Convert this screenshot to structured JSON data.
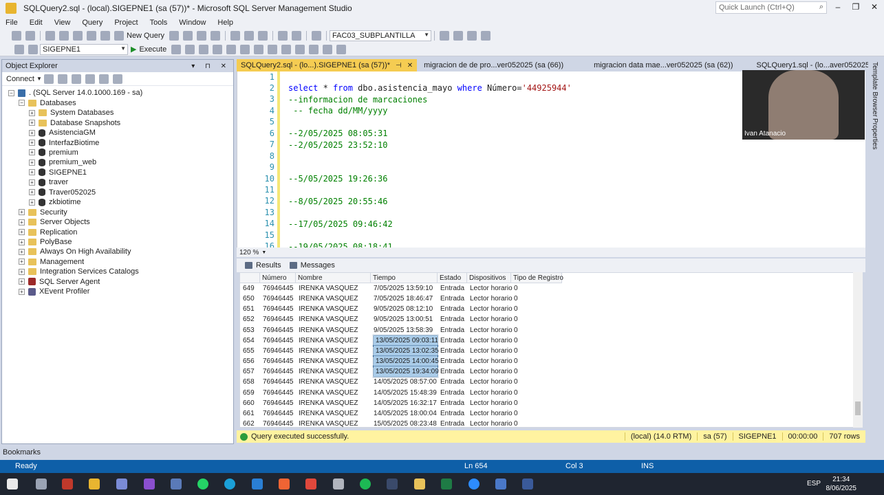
{
  "window": {
    "title": "SQLQuery2.sql - (local).SIGEPNE1 (sa (57))* - Microsoft SQL Server Management Studio",
    "quick_launch_placeholder": "Quick Launch (Ctrl+Q)"
  },
  "menu": [
    "File",
    "Edit",
    "View",
    "Query",
    "Project",
    "Tools",
    "Window",
    "Help"
  ],
  "toolbar": {
    "new_query": "New Query",
    "solution_combo": "FAC03_SUBPLANTILLA",
    "database_combo": "SIGEPNE1",
    "execute": "Execute"
  },
  "object_explorer": {
    "title": "Object Explorer",
    "connect": "Connect",
    "tree": [
      {
        "label": ". (SQL Server 14.0.1000.169 - sa)",
        "level": 0,
        "icon": "server-icon",
        "exp": "−"
      },
      {
        "label": "Databases",
        "level": 1,
        "icon": "folder-icon",
        "exp": "−"
      },
      {
        "label": "System Databases",
        "level": 2,
        "icon": "folder-icon",
        "exp": "+"
      },
      {
        "label": "Database Snapshots",
        "level": 2,
        "icon": "folder-icon",
        "exp": "+"
      },
      {
        "label": "AsistenciaGM",
        "level": 2,
        "icon": "database-icon",
        "exp": "+"
      },
      {
        "label": "InterfazBiotime",
        "level": 2,
        "icon": "database-icon",
        "exp": "+"
      },
      {
        "label": "premium",
        "level": 2,
        "icon": "database-icon",
        "exp": "+"
      },
      {
        "label": "premium_web",
        "level": 2,
        "icon": "database-icon",
        "exp": "+"
      },
      {
        "label": "SIGEPNE1",
        "level": 2,
        "icon": "database-icon",
        "exp": "+"
      },
      {
        "label": "traver",
        "level": 2,
        "icon": "database-icon",
        "exp": "+"
      },
      {
        "label": "Traver052025",
        "level": 2,
        "icon": "database-icon",
        "exp": "+"
      },
      {
        "label": "zkbiotime",
        "level": 2,
        "icon": "database-icon",
        "exp": "+"
      },
      {
        "label": "Security",
        "level": 1,
        "icon": "folder-icon",
        "exp": "+"
      },
      {
        "label": "Server Objects",
        "level": 1,
        "icon": "folder-icon",
        "exp": "+"
      },
      {
        "label": "Replication",
        "level": 1,
        "icon": "folder-icon",
        "exp": "+"
      },
      {
        "label": "PolyBase",
        "level": 1,
        "icon": "folder-icon",
        "exp": "+"
      },
      {
        "label": "Always On High Availability",
        "level": 1,
        "icon": "folder-icon",
        "exp": "+"
      },
      {
        "label": "Management",
        "level": 1,
        "icon": "folder-icon",
        "exp": "+"
      },
      {
        "label": "Integration Services Catalogs",
        "level": 1,
        "icon": "folder-icon",
        "exp": "+"
      },
      {
        "label": "SQL Server Agent",
        "level": 1,
        "icon": "agent-icon",
        "exp": "+"
      },
      {
        "label": "XEvent Profiler",
        "level": 1,
        "icon": "xevent-icon",
        "exp": "+"
      }
    ]
  },
  "doc_tabs": [
    {
      "label": "SQLQuery2.sql - (lo...).SIGEPNE1 (sa (57))*",
      "active": true
    },
    {
      "label": "migracion de de pro...ver052025 (sa (66))",
      "active": false
    },
    {
      "label": "migracion data mae...ver052025 (sa (62))",
      "active": false
    },
    {
      "label": "SQLQuery1.sql - (lo...aver052025 (sa (51))*",
      "active": false
    }
  ],
  "editor": {
    "line_numbers": [
      "1",
      "2",
      "3",
      "4",
      "5",
      "6",
      "7",
      "8",
      "9",
      "10",
      "11",
      "12",
      "13",
      "14",
      "15",
      "16"
    ],
    "line2": {
      "kw1": "select",
      "rest1": " * ",
      "kw2": "from",
      "ident": " dbo.asistencia_mayo ",
      "kw3": "where",
      "rest2": " Número=",
      "str": "'44925944'"
    },
    "comments": {
      "3": "--informacion de marcaciones",
      "4": " -- fecha dd/MM/yyyy",
      "6": "--2/05/2025 08:05:31",
      "7": "--2/05/2025 23:52:10",
      "10": "--5/05/2025 19:26:36",
      "12": "--8/05/2025 20:55:46",
      "14": "--17/05/2025 09:46:42",
      "16": "--19/05/2025 08:18:41"
    },
    "zoom": "120 %"
  },
  "results": {
    "tabs": [
      "Results",
      "Messages"
    ],
    "columns": [
      "Número",
      "Nombre",
      "Tiempo",
      "Estado",
      "Dispositivos",
      "Tipo de Registro"
    ],
    "rows": [
      [
        "649",
        "76946445",
        "IRENKA  VASQUEZ",
        "7/05/2025 13:59:10",
        "Entrada",
        "Lector horario",
        "0"
      ],
      [
        "650",
        "76946445",
        "IRENKA  VASQUEZ",
        "7/05/2025 18:46:47",
        "Entrada",
        "Lector horario",
        "0"
      ],
      [
        "651",
        "76946445",
        "IRENKA  VASQUEZ",
        "9/05/2025 08:12:10",
        "Entrada",
        "Lector horario",
        "0"
      ],
      [
        "652",
        "76946445",
        "IRENKA  VASQUEZ",
        "9/05/2025 13:00:51",
        "Entrada",
        "Lector horario",
        "0"
      ],
      [
        "653",
        "76946445",
        "IRENKA  VASQUEZ",
        "9/05/2025 13:58:39",
        "Entrada",
        "Lector horario",
        "0"
      ],
      [
        "654",
        "76946445",
        "IRENKA  VASQUEZ",
        "13/05/2025 09:03:11",
        "Entrada",
        "Lector horario",
        "0"
      ],
      [
        "655",
        "76946445",
        "IRENKA  VASQUEZ",
        "13/05/2025 13:02:35",
        "Entrada",
        "Lector horario",
        "0"
      ],
      [
        "656",
        "76946445",
        "IRENKA  VASQUEZ",
        "13/05/2025 14:00:45",
        "Entrada",
        "Lector horario",
        "0"
      ],
      [
        "657",
        "76946445",
        "IRENKA  VASQUEZ",
        "13/05/2025 19:34:09",
        "Entrada",
        "Lector horario",
        "0"
      ],
      [
        "658",
        "76946445",
        "IRENKA  VASQUEZ",
        "14/05/2025 08:57:00",
        "Entrada",
        "Lector horario",
        "0"
      ],
      [
        "659",
        "76946445",
        "IRENKA  VASQUEZ",
        "14/05/2025 15:48:39",
        "Entrada",
        "Lector horario",
        "0"
      ],
      [
        "660",
        "76946445",
        "IRENKA  VASQUEZ",
        "14/05/2025 16:32:17",
        "Entrada",
        "Lector horario",
        "0"
      ],
      [
        "661",
        "76946445",
        "IRENKA  VASQUEZ",
        "14/05/2025 18:00:04",
        "Entrada",
        "Lector horario",
        "0"
      ],
      [
        "662",
        "76946445",
        "IRENKA  VASQUEZ",
        "15/05/2025 08:23:48",
        "Entrada",
        "Lector horario",
        "0"
      ]
    ],
    "selected_rows": [
      "654",
      "655",
      "656",
      "657"
    ]
  },
  "query_status": {
    "message": "Query executed successfully.",
    "server": "(local) (14.0 RTM)",
    "user": "sa (57)",
    "database": "SIGEPNE1",
    "time": "00:00:00",
    "rows": "707 rows"
  },
  "bookmarks": "Bookmarks",
  "statusbar": {
    "ready": "Ready",
    "ln": "Ln 654",
    "col": "Col 3",
    "ins": "INS"
  },
  "webcam": {
    "name": "Ivan Atanacio"
  },
  "side_tabs": [
    "Template Browser",
    "Properties"
  ],
  "taskbar": {
    "lang": "ESP",
    "time": "21:34",
    "date": "8/06/2025"
  },
  "colors": {
    "accent_tab": "#f5cc52",
    "statusbar": "#0e5fa8",
    "selection": "#a9cbe8",
    "query_ok": "#fff3a0"
  }
}
